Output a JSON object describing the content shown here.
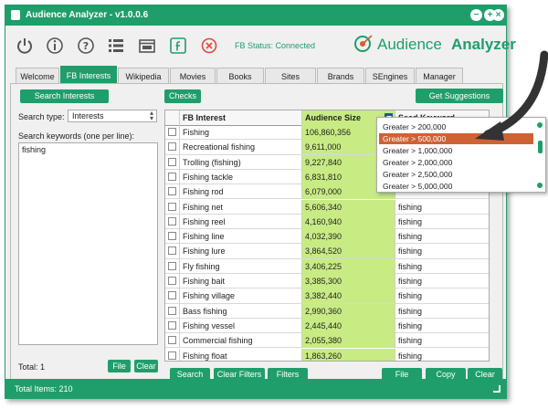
{
  "window": {
    "title": "Audience Analyzer - v1.0.0.6"
  },
  "toolbar": {
    "status": "FB Status: Connected",
    "logo_word1": "Audience",
    "logo_word2": "Analyzer",
    "icons": [
      "power-icon",
      "info-icon",
      "help-icon",
      "list-icon",
      "window-icon",
      "facebook-icon",
      "close-circle-icon"
    ]
  },
  "tabs": [
    "Welcome",
    "FB Interests",
    "Wikipedia",
    "Movies",
    "Books",
    "Sites",
    "Brands",
    "SEngines",
    "Manager"
  ],
  "active_tab": "FB Interests",
  "left": {
    "search_button": "Search Interests",
    "search_type_label": "Search type:",
    "search_type_value": "Interests",
    "keywords_label": "Search keywords (one per line):",
    "keywords_value": "fishing",
    "total": "Total: 1",
    "file_button": "File",
    "clear_button": "Clear"
  },
  "main": {
    "checks_button": "Checks",
    "suggestions_button": "Get Suggestions",
    "columns": [
      "FB Interest",
      "Audience Size",
      "Seed Keyword"
    ],
    "rows": [
      {
        "interest": "Fishing",
        "size": "106,860,356",
        "seed": ""
      },
      {
        "interest": "Recreational fishing",
        "size": "9,611,000",
        "seed": ""
      },
      {
        "interest": "Trolling (fishing)",
        "size": "9,227,840",
        "seed": ""
      },
      {
        "interest": "Fishing tackle",
        "size": "6,831,810",
        "seed": ""
      },
      {
        "interest": "Fishing rod",
        "size": "6,079,000",
        "seed": ""
      },
      {
        "interest": "Fishing net",
        "size": "5,606,340",
        "seed": "fishing"
      },
      {
        "interest": "Fishing reel",
        "size": "4,160,940",
        "seed": "fishing"
      },
      {
        "interest": "Fishing line",
        "size": "4,032,390",
        "seed": "fishing"
      },
      {
        "interest": "Fishing lure",
        "size": "3,864,520",
        "seed": "fishing"
      },
      {
        "interest": "Fly fishing",
        "size": "3,406,225",
        "seed": "fishing"
      },
      {
        "interest": "Fishing bait",
        "size": "3,385,300",
        "seed": "fishing"
      },
      {
        "interest": "Fishing village",
        "size": "3,382,440",
        "seed": "fishing"
      },
      {
        "interest": "Bass fishing",
        "size": "2,990,360",
        "seed": "fishing"
      },
      {
        "interest": "Fishing vessel",
        "size": "2,445,440",
        "seed": "fishing"
      },
      {
        "interest": "Commercial fishing",
        "size": "2,055,380",
        "seed": "fishing"
      },
      {
        "interest": "Fishing float",
        "size": "1,863,260",
        "seed": "fishing"
      }
    ],
    "bottom_buttons": {
      "search": "Search",
      "clear_filters": "Clear Filters",
      "filters": "Filters",
      "file": "File",
      "copy": "Copy",
      "clear": "Clear"
    }
  },
  "dropdown": {
    "options": [
      "Greater > 200,000",
      "Greater > 500,000",
      "Greater > 1,000,000",
      "Greater > 2,000,000",
      "Greater > 2,500,000",
      "Greater > 5,000,000"
    ],
    "selected": "Greater > 500,000"
  },
  "footer": {
    "total_items": "Total Items: 210"
  },
  "colors": {
    "accent": "#1f9e6b",
    "highlight": "#c8eb84",
    "selected": "#cf6235"
  }
}
